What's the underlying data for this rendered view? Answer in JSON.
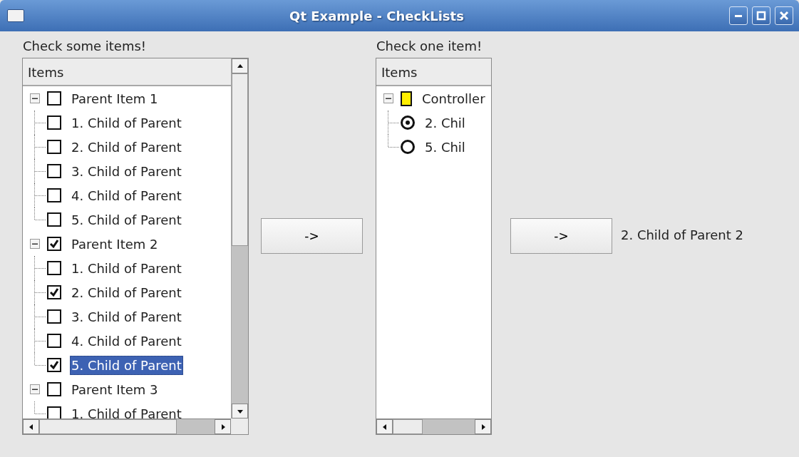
{
  "window": {
    "title": "Qt Example - CheckLists"
  },
  "left_panel": {
    "label": "Check some items!",
    "tree": {
      "header": "Items",
      "items": [
        {
          "label": "Parent Item 1",
          "kind": "checkbox",
          "checked": false,
          "selected": false,
          "expanded": true,
          "children": [
            {
              "label": "1. Child of Parent",
              "kind": "checkbox",
              "checked": false,
              "selected": false
            },
            {
              "label": "2. Child of Parent",
              "kind": "checkbox",
              "checked": false,
              "selected": false
            },
            {
              "label": "3. Child of Parent",
              "kind": "checkbox",
              "checked": false,
              "selected": false
            },
            {
              "label": "4. Child of Parent",
              "kind": "checkbox",
              "checked": false,
              "selected": false
            },
            {
              "label": "5. Child of Parent",
              "kind": "checkbox",
              "checked": false,
              "selected": false
            }
          ]
        },
        {
          "label": "Parent Item 2",
          "kind": "checkbox",
          "checked": true,
          "selected": false,
          "expanded": true,
          "children": [
            {
              "label": "1. Child of Parent",
              "kind": "checkbox",
              "checked": false,
              "selected": false
            },
            {
              "label": "2. Child of Parent",
              "kind": "checkbox",
              "checked": true,
              "selected": false
            },
            {
              "label": "3. Child of Parent",
              "kind": "checkbox",
              "checked": false,
              "selected": false
            },
            {
              "label": "4. Child of Parent",
              "kind": "checkbox",
              "checked": false,
              "selected": false
            },
            {
              "label": "5. Child of Parent",
              "kind": "checkbox",
              "checked": true,
              "selected": true
            }
          ]
        },
        {
          "label": "Parent Item 3",
          "kind": "checkbox",
          "checked": false,
          "selected": false,
          "expanded": true,
          "children": [
            {
              "label": "1. Child of Parent",
              "kind": "checkbox",
              "checked": false,
              "selected": false
            }
          ]
        }
      ]
    }
  },
  "left_button": {
    "label": "->"
  },
  "right_panel": {
    "label": "Check one item!",
    "tree": {
      "header": "Items",
      "items": [
        {
          "label": "Controller",
          "kind": "controller",
          "partially_checked": true,
          "selected": false,
          "expanded": true,
          "children": [
            {
              "label": "2. Chil",
              "kind": "radio",
              "checked": true,
              "selected": false
            },
            {
              "label": "5. Chil",
              "kind": "radio",
              "checked": false,
              "selected": false
            }
          ]
        }
      ]
    }
  },
  "right_button": {
    "label": "->"
  },
  "result": "2. Child of Parent 2"
}
